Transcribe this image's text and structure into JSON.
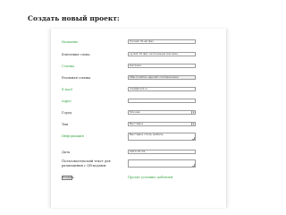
{
  "page": {
    "title": "Создать новый проект:"
  },
  "form": {
    "name": {
      "label": "Название",
      "value": "Іполий т6-ай фес"
    },
    "keywords": {
      "label": "Ключевые слова",
      "value": "кулий т6 фес экспозиция магазин"
    },
    "link": {
      "label": "Ссылка",
      "value": "магазин"
    },
    "real_link": {
      "label": "Реальная ссылка",
      "value": "http://сайтас.ajpсайт.com/магазин/"
    },
    "email": {
      "label": "E-mail",
      "value": "mail@host.ru"
    },
    "address": {
      "label": "Адрес",
      "value": ""
    },
    "city": {
      "label": "Город",
      "value": "Москва"
    },
    "type": {
      "label": "Тип",
      "value": "Выставка"
    },
    "info": {
      "label": "Информация",
      "value": "Выставка стиль мебель"
    },
    "date": {
      "label": "Дата",
      "value": "2013-07-01"
    },
    "qr_text": {
      "label": "Пользовательский текст для размещения с QR-кодами:",
      "value": ""
    },
    "submit_label": "Создать",
    "hint": "Проект успешно добавлен"
  },
  "colors": {
    "green_label": "#3aa845",
    "text": "#333333"
  }
}
